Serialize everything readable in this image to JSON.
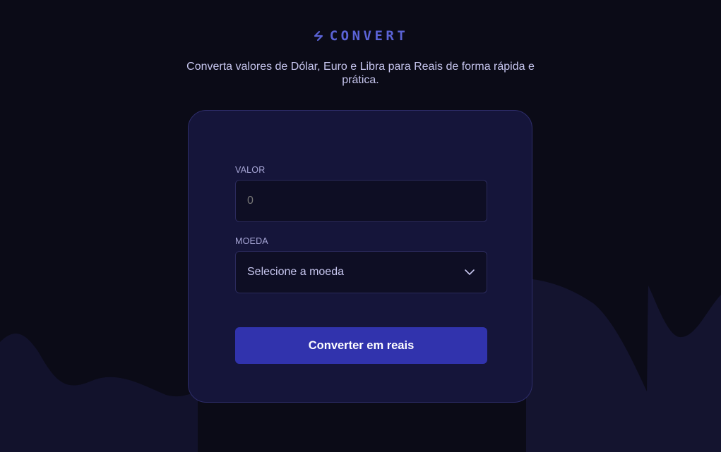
{
  "logo": {
    "text": "CONVERT",
    "icon": "convert-arrows-icon",
    "color": "#5b63d6"
  },
  "subtitle": "Converta valores de Dólar, Euro e Libra para Reais de forma rápida e prática.",
  "form": {
    "value_label": "VALOR",
    "value_input": {
      "value": "",
      "placeholder": "0"
    },
    "currency_label": "MOEDA",
    "currency_select": {
      "selected": "Selecione a moeda",
      "icon": "chevron-down-icon"
    },
    "submit_label": "Converter em reais"
  },
  "colors": {
    "background": "#0b0b17",
    "card": "#15153a",
    "field": "#0e0e24",
    "accent": "#3133ad",
    "text_muted": "#c7c6ef"
  }
}
